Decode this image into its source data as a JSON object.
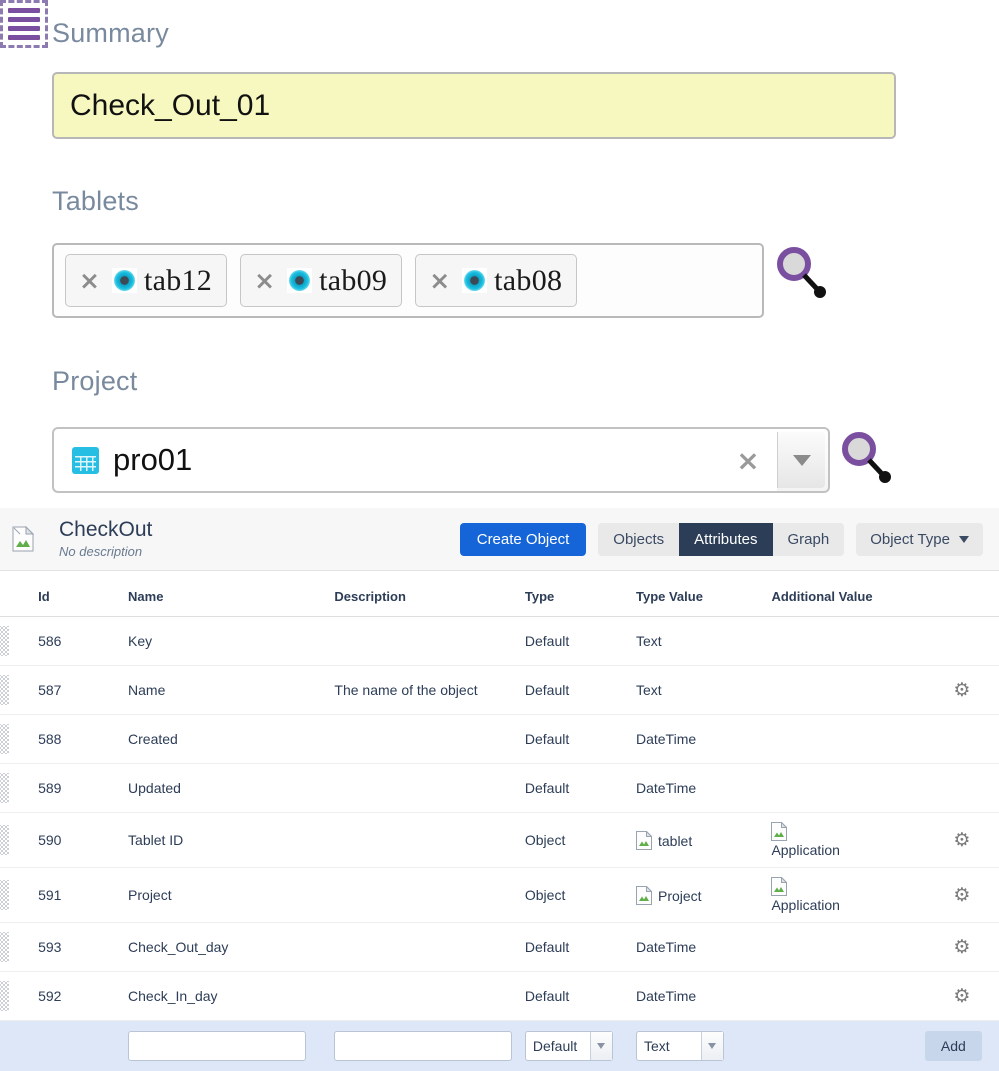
{
  "form": {
    "summary": {
      "label": "Summary",
      "value": "Check_Out_01"
    },
    "tablets": {
      "label": "Tablets",
      "tokens": [
        {
          "name": "tab12",
          "remove": "×"
        },
        {
          "name": "tab09",
          "remove": "×"
        },
        {
          "name": "tab08",
          "remove": "×"
        }
      ]
    },
    "project": {
      "label": "Project",
      "value": "pro01",
      "clear": "×"
    }
  },
  "panel": {
    "title": "CheckOut",
    "subtitle": "No description",
    "create_object_label": "Create Object",
    "tabs": [
      {
        "label": "Objects",
        "active": false
      },
      {
        "label": "Attributes",
        "active": true
      },
      {
        "label": "Graph",
        "active": false
      }
    ],
    "object_type_label": "Object Type"
  },
  "table": {
    "headers": [
      "Id",
      "Name",
      "Description",
      "Type",
      "Type Value",
      "Additional Value"
    ],
    "rows": [
      {
        "id": "586",
        "tag": false,
        "name": "Key",
        "desc": "",
        "type": "Default",
        "type_value": "Text",
        "tv_icon": false,
        "additional": "",
        "add_icon": false,
        "gear": false
      },
      {
        "id": "587",
        "tag": true,
        "name": "Name",
        "desc": "The name of the object",
        "type": "Default",
        "type_value": "Text",
        "tv_icon": false,
        "additional": "",
        "add_icon": false,
        "gear": true
      },
      {
        "id": "588",
        "tag": false,
        "name": "Created",
        "desc": "",
        "type": "Default",
        "type_value": "DateTime",
        "tv_icon": false,
        "additional": "",
        "add_icon": false,
        "gear": false
      },
      {
        "id": "589",
        "tag": false,
        "name": "Updated",
        "desc": "",
        "type": "Default",
        "type_value": "DateTime",
        "tv_icon": false,
        "additional": "",
        "add_icon": false,
        "gear": false
      },
      {
        "id": "590",
        "tag": false,
        "name": "Tablet ID",
        "desc": "",
        "type": "Object",
        "type_value": "tablet",
        "tv_icon": true,
        "additional": "Application",
        "add_icon": true,
        "gear": true
      },
      {
        "id": "591",
        "tag": false,
        "name": "Project",
        "desc": "",
        "type": "Object",
        "type_value": "Project",
        "tv_icon": true,
        "additional": "Application",
        "add_icon": true,
        "gear": true
      },
      {
        "id": "593",
        "tag": false,
        "name": "Check_Out_day",
        "desc": "",
        "type": "Default",
        "type_value": "DateTime",
        "tv_icon": false,
        "additional": "",
        "add_icon": false,
        "gear": true
      },
      {
        "id": "592",
        "tag": false,
        "name": "Check_In_day",
        "desc": "",
        "type": "Default",
        "type_value": "DateTime",
        "tv_icon": false,
        "additional": "",
        "add_icon": false,
        "gear": true
      }
    ],
    "add_row": {
      "name_value": "",
      "name_placeholder": "",
      "desc_value": "",
      "desc_placeholder": "",
      "type_value": "Default",
      "type_value_value": "Text",
      "add_label": "Add"
    }
  },
  "icons": {
    "search": "search-icon",
    "list": "list-icon",
    "gear": "⚙",
    "tag": "🏷",
    "tablet": "tablet-icon",
    "project": "grid-icon",
    "broken_image": "broken-image-icon"
  },
  "colors": {
    "accent_blue": "#1665d8",
    "tab_active": "#2c3e57",
    "summary_bg": "#f7f8bf",
    "purple": "#7b4fa0",
    "cyan": "#26bfe3",
    "addrow_bg": "#dde7f7"
  }
}
